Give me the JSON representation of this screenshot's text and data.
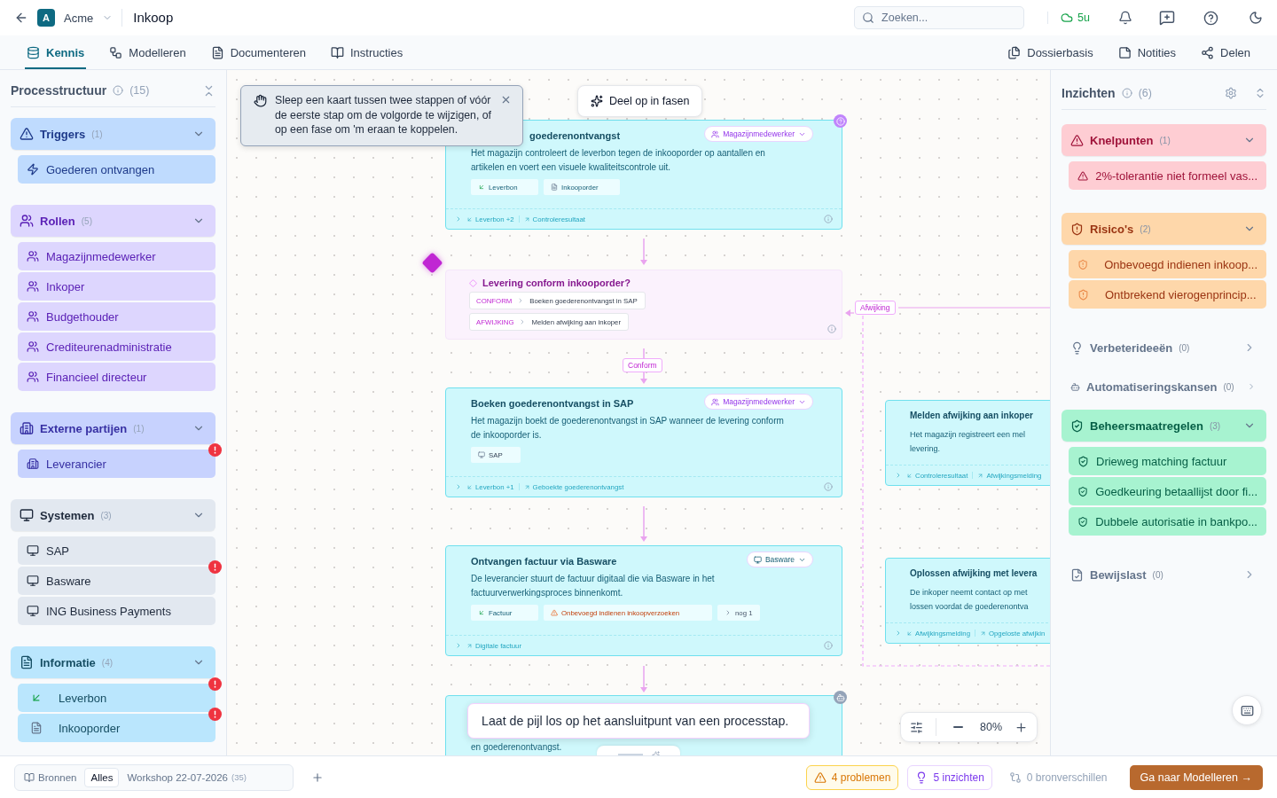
{
  "header": {
    "workspace": {
      "initial": "A",
      "name": "Acme"
    },
    "title": "Inkoop",
    "search": {
      "placeholder": "Zoeken..."
    },
    "sync": "5u"
  },
  "tabs": [
    {
      "label": "Kennis",
      "selected": true
    },
    {
      "label": "Modelleren",
      "selected": false
    },
    {
      "label": "Documenteren",
      "selected": false
    },
    {
      "label": "Instructies",
      "selected": false
    }
  ],
  "tools": [
    "Dossierbasis",
    "Notities",
    "Delen"
  ],
  "sidebar": {
    "title": "Processtructuur",
    "count": "(15)",
    "groups": [
      {
        "kind": "trigger",
        "label": "Triggers",
        "count": "(1)",
        "expanded": true,
        "items": [
          {
            "label": "Goederen ontvangen",
            "flagged": false
          }
        ]
      },
      {
        "kind": "role",
        "label": "Rollen",
        "count": "(5)",
        "expanded": true,
        "items": [
          {
            "label": "Magazijnmedewerker",
            "flagged": false
          },
          {
            "label": "Inkoper",
            "flagged": false
          },
          {
            "label": "Budgethouder",
            "flagged": false
          },
          {
            "label": "Crediteurenadministratie",
            "flagged": false
          },
          {
            "label": "Financieel directeur",
            "flagged": false
          }
        ]
      },
      {
        "kind": "external",
        "label": "Externe partijen",
        "count": "(1)",
        "expanded": true,
        "items": [
          {
            "label": "Leverancier",
            "flagged": true
          }
        ]
      },
      {
        "kind": "system",
        "label": "Systemen",
        "count": "(3)",
        "expanded": true,
        "items": [
          {
            "label": "SAP",
            "flagged": false
          },
          {
            "label": "Basware",
            "flagged": true
          },
          {
            "label": "ING Business Payments",
            "flagged": false
          }
        ]
      },
      {
        "kind": "information",
        "label": "Informatie",
        "count": "(4)",
        "expanded": true,
        "items": [
          {
            "kind": "input",
            "label": "Leverbon",
            "flagged": true
          },
          {
            "kind": "document",
            "label": "Inkooporder",
            "flagged": true
          }
        ]
      }
    ]
  },
  "canvas": {
    "hint": "Sleep een kaart tussen twee stappen of vóór de eerste stap om de volgorde te wijzigen, of op een fase om 'm eraan te koppelen.",
    "split_button": "Deel op in fasen",
    "steps": [
      {
        "title": "goederenontvangst",
        "owner": {
          "kind": "role",
          "label": "Magazijnmedewerker"
        },
        "lines": [
          "Het magazijn controleert de leverbon tegen de inkooporder op aantallen en",
          "artikelen en voert een visuele kwaliteitscontrole uit."
        ],
        "tags": [
          {
            "kind": "input",
            "label": "Leverbon"
          },
          {
            "kind": "document",
            "label": "Inkooporder"
          }
        ],
        "inputs": "Leverbon +2",
        "outputs": "Controleresultaat"
      },
      {
        "title": "Boeken goederenontvangst in SAP",
        "owner": {
          "kind": "role",
          "label": "Magazijnmedewerker"
        },
        "lines": [
          "Het magazijn boekt de goederenontvangst in SAP wanneer de levering conform",
          "de inkooporder is."
        ],
        "tags": [
          {
            "kind": "system",
            "label": "SAP"
          }
        ],
        "inputs": "Leverbon +1",
        "outputs": "Geboekte goederenontvangst"
      },
      {
        "title": "Ontvangen factuur via Basware",
        "owner": {
          "kind": "system",
          "label": "Basware"
        },
        "lines": [
          "De leverancier stuurt de factuur digitaal die via Basware in het",
          "factuurverwerkingsproces binnenkomt."
        ],
        "tags": [
          {
            "kind": "input",
            "label": "Factuur"
          },
          {
            "kind": "risk",
            "label": "Onbevoegd indienen inkoopverzoeken"
          },
          {
            "kind": "more",
            "label": "nog 1"
          }
        ],
        "outputs": "Digitale factuur"
      },
      {
        "title": "Melden afwijking aan inkoper",
        "lines": [
          "Het magazijn registreert een mel",
          "levering."
        ],
        "inputs": "Controleresultaat",
        "outputs": "Afwijkingsmelding"
      },
      {
        "title": "Oplossen afwijking met levera",
        "lines": [
          "De inkoper neemt contact op met",
          "lossen voordat de goederenontva"
        ],
        "inputs": "Afwijkingsmelding",
        "outputs": "Opgeloste afwijkin"
      },
      {
        "lines": [
          "en goederenontvangst."
        ]
      }
    ],
    "decision": {
      "question": "Levering conform inkooporder?",
      "branches": [
        {
          "label": "CONFORM",
          "target": "Boeken goederenontvangst in SAP"
        },
        {
          "label": "AFWIJKING",
          "target": "Melden afwijking aan inkoper"
        }
      ]
    },
    "edge_labels": [
      "Conform",
      "Afwijking"
    ],
    "toast": "Laat de pijl los op het aansluitpunt van een processtap.",
    "zoom": "80%"
  },
  "insights": {
    "title": "Inzichten",
    "count": "(6)",
    "groups": [
      {
        "kind": "problem",
        "label": "Knelpunten",
        "count": "(1)",
        "expanded": true,
        "items": [
          "2%-tolerantie niet formeel vas..."
        ]
      },
      {
        "kind": "risk",
        "label": "Risico's",
        "count": "(2)",
        "expanded": true,
        "items": [
          "Onbevoegd indienen inkoop...",
          "Ontbrekend vierogenprincip..."
        ]
      },
      {
        "kind": "idea",
        "label": "Verbeterideeën",
        "count": "(0)",
        "expanded": false
      },
      {
        "kind": "automation",
        "label": "Automatiseringskansen",
        "count": "(0)",
        "expanded": false
      },
      {
        "kind": "control",
        "label": "Beheersmaatregelen",
        "count": "(3)",
        "expanded": true,
        "items": [
          "Drieweg matching factuur",
          "Goedkeuring betaallijst door fi...",
          "Dubbele autorisatie in bankpo..."
        ]
      },
      {
        "kind": "evidence",
        "label": "Bewijslast",
        "count": "(0)",
        "expanded": false
      }
    ]
  },
  "footer": {
    "filters": [
      {
        "label": "Bronnen",
        "selected": false
      },
      {
        "label": "Alles",
        "selected": true
      },
      {
        "label": "Workshop 22-07-2026",
        "count": "(35)",
        "selected": false
      }
    ],
    "problems": "4 problemen",
    "insights": "5 inzichten",
    "differences": "0 bronverschillen",
    "cta": "Ga naar Modelleren →"
  }
}
